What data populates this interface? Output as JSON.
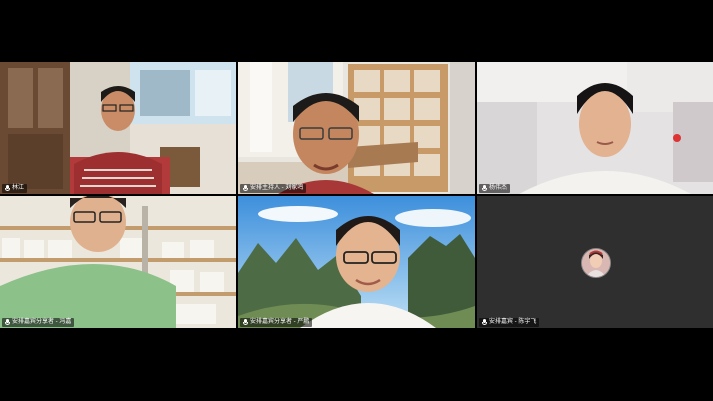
{
  "meeting": {
    "active_speaker_color": "#3ddc3d",
    "participants": [
      {
        "id": "p1",
        "name": "林江",
        "mic": "mic-icon",
        "kind": "video"
      },
      {
        "id": "p2",
        "name": "安排主持人 - 刘家鸣",
        "mic": "mic-icon",
        "kind": "video",
        "active": true
      },
      {
        "id": "p3",
        "name": "杨伟杰",
        "mic": "mic-icon",
        "kind": "video"
      },
      {
        "id": "p4",
        "name": "安排嘉宾分享者 - 冯嘉",
        "mic": "mic-icon",
        "kind": "video"
      },
      {
        "id": "p5",
        "name": "安排嘉宾分享者 - 严鹏",
        "mic": "mic-icon",
        "kind": "video"
      },
      {
        "id": "p6",
        "name": "安排嘉宾 - 陈宇飞",
        "mic": "mic-icon",
        "kind": "avatar"
      }
    ]
  }
}
